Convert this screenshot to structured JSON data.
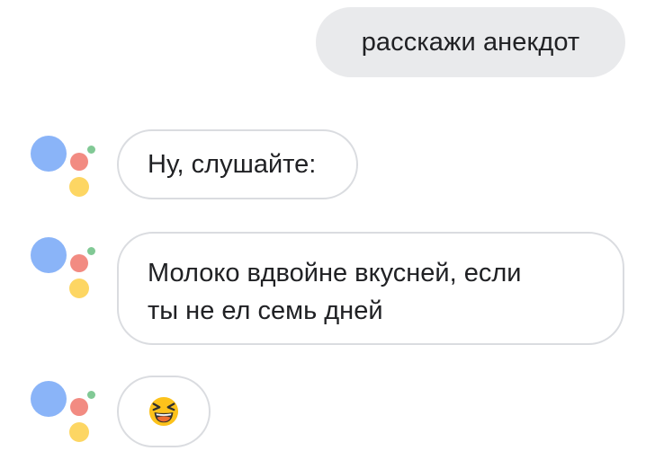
{
  "conversation": {
    "user_message": "расскажи анекдот",
    "assistant_messages": [
      {
        "text": "Ну, слушайте:"
      },
      {
        "lines": [
          "Молоко вдвойне вкусней, если",
          "ты не ел семь дней"
        ]
      },
      {
        "emoji": "laughing-squinting-face",
        "text": "😆"
      }
    ]
  },
  "colors": {
    "user_bubble": "#e9eaec",
    "bubble_border": "#dadce0",
    "logo_blue": "#8ab4f8",
    "logo_red": "#f28b82",
    "logo_yellow": "#fdd663",
    "logo_green": "#81c995"
  },
  "icons": {
    "assistant_logo": "google-assistant-logo-icon"
  }
}
